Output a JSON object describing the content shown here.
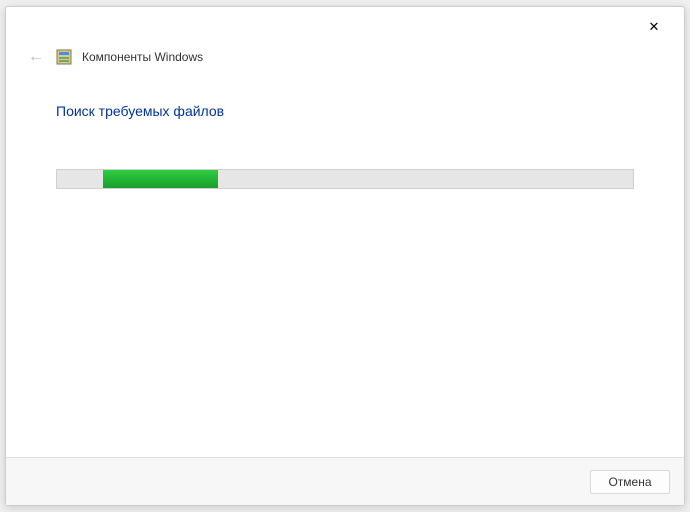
{
  "header": {
    "window_title": "Компоненты Windows"
  },
  "content": {
    "status_text": "Поиск требуемых файлов"
  },
  "progress": {
    "left_percent": "8",
    "width_percent": "20"
  },
  "footer": {
    "cancel_label": "Отмена"
  }
}
